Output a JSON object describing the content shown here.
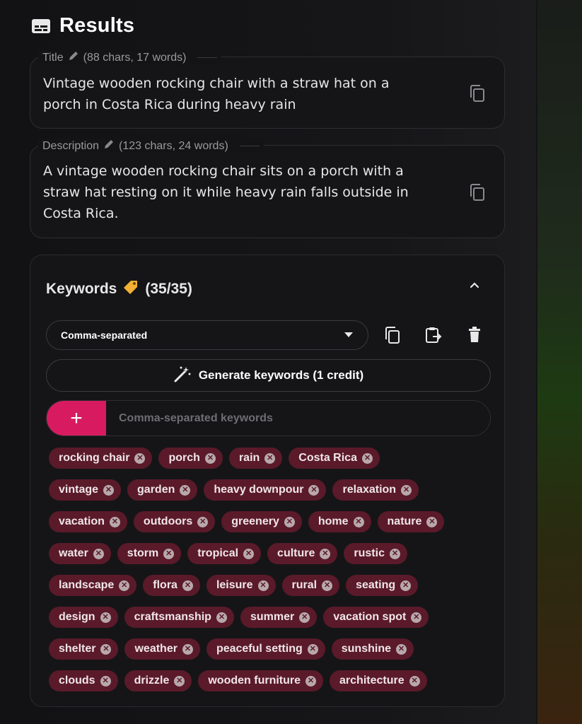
{
  "header": {
    "title": "Results"
  },
  "title_field": {
    "label": "Title",
    "stats": "(88 chars, 17 words)",
    "lines": [
      "Vintage wooden rocking chair with a straw hat on a",
      "porch in Costa Rica during heavy rain"
    ]
  },
  "description_field": {
    "label": "Description",
    "stats": "(123 chars, 24 words)",
    "lines": [
      "A vintage wooden rocking chair sits on a porch with a",
      "straw hat resting on it while heavy rain falls outside in",
      "Costa Rica."
    ]
  },
  "keywords": {
    "title": "Keywords",
    "count": "(35/35)",
    "format_select": "Comma-separated",
    "generate_label": "Generate keywords (1 credit)",
    "input_placeholder": "Comma-separated keywords",
    "add_label": "+",
    "rows": [
      [
        "rocking chair",
        "porch",
        "rain",
        "Costa Rica"
      ],
      [
        "vintage",
        "garden",
        "heavy downpour",
        "relaxation"
      ],
      [
        "vacation",
        "outdoors",
        "greenery",
        "home",
        "nature"
      ],
      [
        "water",
        "storm",
        "tropical",
        "culture",
        "rustic"
      ],
      [
        "landscape",
        "flora",
        "leisure",
        "rural",
        "seating"
      ],
      [
        "design",
        "craftsmanship",
        "summer",
        "vacation spot"
      ],
      [
        "shelter",
        "weather",
        "peaceful setting",
        "sunshine"
      ],
      [
        "clouds",
        "drizzle",
        "wooden furniture",
        "architecture"
      ]
    ]
  },
  "icons": {
    "results": "subtitles-icon",
    "edit": "pencil-icon",
    "copy": "copy-icon",
    "tag": "tag-icon",
    "chevron": "chevron-up-icon",
    "dropdown": "caret-down-icon",
    "paste": "paste-icon",
    "delete": "trash-icon",
    "magic": "magic-wand-icon",
    "remove": "remove-circle-icon"
  },
  "colors": {
    "accent": "#d81b60",
    "chip_bg": "#5a1a2a",
    "tag_icon": "#f2b134"
  }
}
